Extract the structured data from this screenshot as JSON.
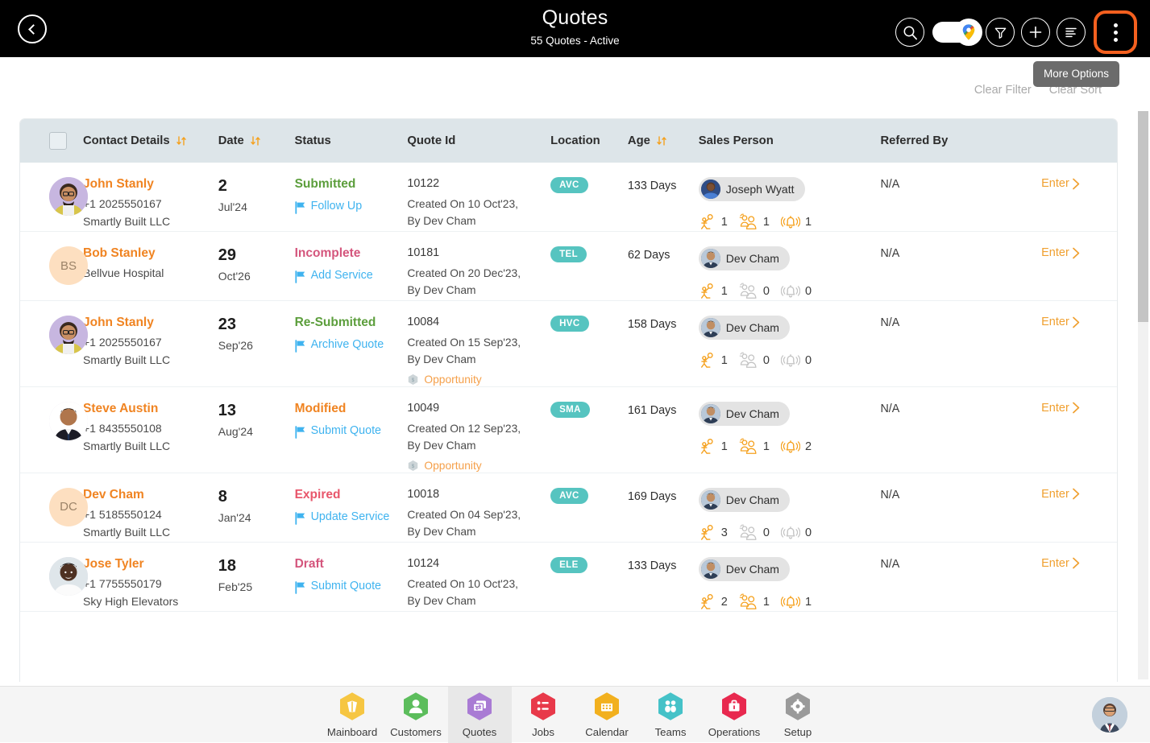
{
  "header": {
    "title": "Quotes",
    "subtitle": "55 Quotes - Active",
    "back_icon": "chevron-left-icon",
    "icons": [
      {
        "name": "search-icon"
      },
      {
        "name": "map-toggle"
      },
      {
        "name": "filter-icon"
      },
      {
        "name": "add-icon"
      },
      {
        "name": "sort-list-icon"
      },
      {
        "name": "more-options-icon"
      }
    ]
  },
  "tooltip": {
    "text": "More Options"
  },
  "toolbar": {
    "clear_filter": "Clear Filter",
    "clear_sort": "Clear Sort"
  },
  "table": {
    "columns": [
      {
        "key": "checkbox",
        "label": ""
      },
      {
        "key": "contact",
        "label": "Contact Details",
        "sortable": true
      },
      {
        "key": "date",
        "label": "Date",
        "sortable": true
      },
      {
        "key": "status",
        "label": "Status",
        "sortable": false
      },
      {
        "key": "quote_id",
        "label": "Quote Id",
        "sortable": false
      },
      {
        "key": "location",
        "label": "Location",
        "sortable": false
      },
      {
        "key": "age",
        "label": "Age",
        "sortable": true
      },
      {
        "key": "sales_person",
        "label": "Sales Person",
        "sortable": false
      },
      {
        "key": "referred_by",
        "label": "Referred By",
        "sortable": false
      },
      {
        "key": "enter",
        "label": ""
      }
    ],
    "enter_label": "Enter",
    "rows": [
      {
        "avatar_type": "photo",
        "avatar_style": "john",
        "name": "John Stanly",
        "phone": "+1 2025550167",
        "company": "Smartly Built LLC",
        "date_day": "2",
        "date_month": "Jul'24",
        "status": "Submitted",
        "status_color": "#5c9e3c",
        "action": "Follow Up",
        "quote_id": "10122",
        "created_line1": "Created On 10 Oct'23,",
        "created_line2": "By Dev Cham",
        "opportunity": null,
        "location": "AVC",
        "age": "133 Days",
        "sales_person": "Joseph Wyatt",
        "sp_avatar": "joseph",
        "metric_inspection": "1",
        "metric_team": "1",
        "metric_alert": "1",
        "referred_by": "N/A"
      },
      {
        "avatar_type": "initials",
        "avatar_style": "BS",
        "name": "Bob Stanley",
        "phone": "",
        "company": "Bellvue Hospital",
        "date_day": "29",
        "date_month": "Oct'26",
        "status": "Incomplete",
        "status_color": "#d4557c",
        "action": "Add Service",
        "quote_id": "10181",
        "created_line1": "Created On 20 Dec'23,",
        "created_line2": "By Dev Cham",
        "opportunity": null,
        "location": "TEL",
        "age": "62 Days",
        "sales_person": "Dev Cham",
        "sp_avatar": "dev",
        "metric_inspection": "1",
        "metric_team": "0",
        "metric_alert": "0",
        "referred_by": "N/A"
      },
      {
        "avatar_type": "photo",
        "avatar_style": "john",
        "name": "John Stanly",
        "phone": "+1 2025550167",
        "company": "Smartly Built LLC",
        "date_day": "23",
        "date_month": "Sep'26",
        "status": "Re-Submitted",
        "status_color": "#5c9e3c",
        "action": "Archive Quote",
        "quote_id": "10084",
        "created_line1": "Created On 15 Sep'23,",
        "created_line2": "By Dev Cham",
        "opportunity": "Opportunity",
        "location": "HVC",
        "age": "158 Days",
        "sales_person": "Dev Cham",
        "sp_avatar": "dev",
        "metric_inspection": "1",
        "metric_team": "0",
        "metric_alert": "0",
        "referred_by": "N/A"
      },
      {
        "avatar_type": "photo",
        "avatar_style": "steve",
        "name": "Steve Austin",
        "phone": "+1 8435550108",
        "company": "Smartly Built LLC",
        "date_day": "13",
        "date_month": "Aug'24",
        "status": "Modified",
        "status_color": "#f08422",
        "action": "Submit Quote",
        "quote_id": "10049",
        "created_line1": "Created On 12 Sep'23,",
        "created_line2": "By Dev Cham",
        "opportunity": "Opportunity",
        "location": "SMA",
        "age": "161 Days",
        "sales_person": "Dev Cham",
        "sp_avatar": "dev",
        "metric_inspection": "1",
        "metric_team": "1",
        "metric_alert": "2",
        "referred_by": "N/A"
      },
      {
        "avatar_type": "initials",
        "avatar_style": "DC",
        "name": "Dev Cham",
        "phone": "+1 5185550124",
        "company": "Smartly Built LLC",
        "date_day": "8",
        "date_month": "Jan'24",
        "status": "Expired",
        "status_color": "#e8566b",
        "action": "Update Service",
        "quote_id": "10018",
        "created_line1": "Created On 04 Sep'23,",
        "created_line2": "By Dev Cham",
        "opportunity": null,
        "location": "AVC",
        "age": "169 Days",
        "sales_person": "Dev Cham",
        "sp_avatar": "dev",
        "metric_inspection": "3",
        "metric_team": "0",
        "metric_alert": "0",
        "referred_by": "N/A"
      },
      {
        "avatar_type": "photo",
        "avatar_style": "jose",
        "name": "Jose Tyler",
        "phone": "+1 7755550179",
        "company": "Sky High Elevators",
        "date_day": "18",
        "date_month": "Feb'25",
        "status": "Draft",
        "status_color": "#d4557c",
        "action": "Submit Quote",
        "quote_id": "10124",
        "created_line1": "Created On 10 Oct'23,",
        "created_line2": "By Dev Cham",
        "opportunity": null,
        "location": "ELE",
        "age": "133 Days",
        "sales_person": "Dev Cham",
        "sp_avatar": "dev",
        "metric_inspection": "2",
        "metric_team": "1",
        "metric_alert": "1",
        "referred_by": "N/A"
      }
    ]
  },
  "bottom_nav": {
    "items": [
      {
        "label": "Mainboard",
        "icon": "mainboard-icon",
        "color": "#f6c642",
        "active": false
      },
      {
        "label": "Customers",
        "icon": "customers-icon",
        "color": "#5cbd5c",
        "active": false
      },
      {
        "label": "Quotes",
        "icon": "quotes-icon",
        "color": "#a97bd4",
        "active": true
      },
      {
        "label": "Jobs",
        "icon": "jobs-icon",
        "color": "#e8394a",
        "active": false
      },
      {
        "label": "Calendar",
        "icon": "calendar-icon",
        "color": "#f2b01e",
        "active": false
      },
      {
        "label": "Teams",
        "icon": "teams-icon",
        "color": "#45c2c8",
        "active": false
      },
      {
        "label": "Operations",
        "icon": "operations-icon",
        "color": "#e8294f",
        "active": false
      },
      {
        "label": "Setup",
        "icon": "setup-icon",
        "color": "#9a9a9a",
        "active": false
      }
    ]
  },
  "colors": {
    "accent_orange": "#f08422",
    "highlight": "#f4601f",
    "chip_teal": "#56c4c0",
    "link_blue": "#3fb3ef",
    "header_bg": "#dde5e9"
  }
}
